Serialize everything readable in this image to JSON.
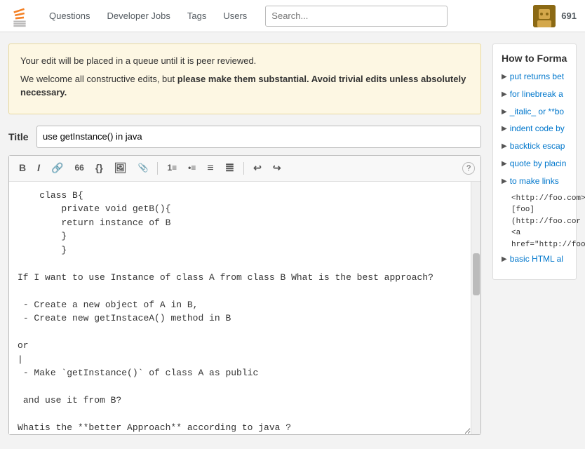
{
  "header": {
    "logo_alt": "Stack Overflow",
    "nav": [
      {
        "label": "Questions",
        "id": "nav-questions"
      },
      {
        "label": "Developer Jobs",
        "id": "nav-jobs"
      },
      {
        "label": "Tags",
        "id": "nav-tags"
      },
      {
        "label": "Users",
        "id": "nav-users"
      }
    ],
    "search_placeholder": "Search...",
    "reputation": "691"
  },
  "alert": {
    "line1": "Your edit will be placed in a queue until it is peer reviewed.",
    "line2_pre": "We welcome all constructive edits, but ",
    "line2_bold": "please make them substantial. Avoid trivial edits unless absolutely necessary.",
    "line2_bold_text": "please make them substantial. Avoid trivial edits unless absolutely necessary."
  },
  "title_label": "Title",
  "title_value": "use getInstance() in java",
  "toolbar": {
    "buttons": [
      {
        "label": "B",
        "name": "bold-button",
        "title": "Bold"
      },
      {
        "label": "I",
        "name": "italic-button",
        "title": "Italic"
      },
      {
        "label": "🔗",
        "name": "link-button",
        "title": "Link"
      },
      {
        "label": "\"\"",
        "name": "blockquote-button",
        "title": "Blockquote"
      },
      {
        "label": "{}",
        "name": "code-button",
        "title": "Code"
      },
      {
        "label": "🖼",
        "name": "image-button",
        "title": "Image"
      },
      {
        "label": "📄",
        "name": "attach-button",
        "title": "Attach"
      },
      {
        "label": "1.",
        "name": "ordered-list-button",
        "title": "Ordered List"
      },
      {
        "label": "•",
        "name": "unordered-list-button",
        "title": "Unordered List"
      },
      {
        "label": "≡",
        "name": "indent-button",
        "title": "Indent"
      },
      {
        "label": "≣",
        "name": "outdent-button",
        "title": "Outdent"
      },
      {
        "label": "↩",
        "name": "undo-button",
        "title": "Undo"
      },
      {
        "label": "↪",
        "name": "redo-button",
        "title": "Redo"
      }
    ],
    "help_label": "?"
  },
  "editor_content": "    class B{\n        private void getB(){\n        return instance of B\n        }\n        }\n\nIf I want to use Instance of class A from class B What is the best approach?\n\n - Create a new object of A in B,\n - Create new getInstaceA() method in B\n\nor\n|\n - Make `getInstance()` of class A as public\n\n and use it from B?\n\nWhatis the **better Approach** according to java ?",
  "sidebar": {
    "title": "How to Forma",
    "items": [
      {
        "text": "put returns bet",
        "link": true
      },
      {
        "text": "for linebreak a",
        "link": true
      },
      {
        "text": "_italic_ or **bo",
        "link": true
      },
      {
        "text": "indent code by",
        "link": true
      },
      {
        "text": "backtick escap",
        "link": true
      },
      {
        "text": "quote by placin",
        "link": true
      },
      {
        "text": "to make links",
        "link": true
      }
    ],
    "code_examples": [
      "<http://foo.com>",
      "[foo](http://foo.cor",
      "<a href=\"http://foo"
    ],
    "basic_html": "basic HTML al"
  }
}
